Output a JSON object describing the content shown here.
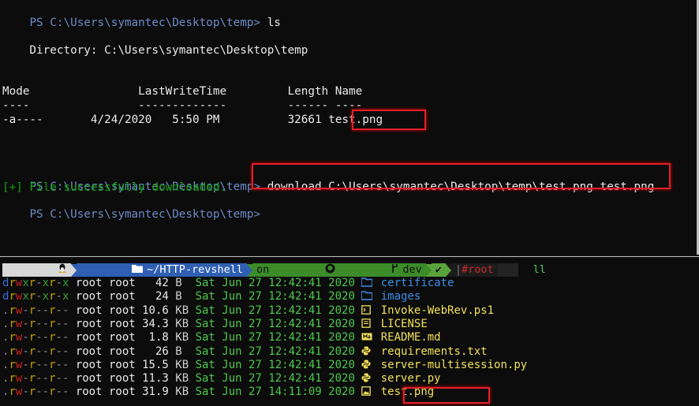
{
  "top_terminal": {
    "cmd1_prompt": "PS C:\\Users\\symantec\\Desktop\\temp>",
    "cmd1": "ls",
    "directory_label": "    Directory: C:\\Users\\symantec\\Desktop\\temp",
    "table_header": "Mode                LastWriteTime         Length Name",
    "table_rule": "----                -------------         ------ ----",
    "row_mode": "-a----",
    "row_date": "4/24/2020",
    "row_time": "5:50 PM",
    "row_length": "32661",
    "row_name": "test.png",
    "cmd2_prompt": "PS C:\\Users\\symantec\\Desktop\\temp>",
    "cmd2": "download C:\\Users\\symantec\\Desktop\\temp\\test.png test.png",
    "success_msg": "[+] File successfully downloaded.",
    "cmd3_prompt": "PS C:\\Users\\symantec\\Desktop\\temp>"
  },
  "bottom_terminal": {
    "prompt": {
      "os_icon": "linux-icon",
      "path_icon": "folder-icon",
      "path": "~/HTTP-revshell",
      "git_on": "on",
      "git_icon": "github-icon",
      "branch_icon": "branch-icon",
      "branch": "dev",
      "status_check": "✔",
      "root_label": "#root",
      "command": "ll"
    },
    "listing": [
      {
        "perm": "drwxr-xr-x",
        "owner": "root",
        "group": "root",
        "size": "42",
        "unit": "B",
        "date": "Sat Jun 27 12:42:41 2020",
        "icon": "folder-icon",
        "name": "certificate",
        "is_dir": true
      },
      {
        "perm": "drwxr-xr-x",
        "owner": "root",
        "group": "root",
        "size": "24",
        "unit": "B",
        "date": "Sat Jun 27 12:42:41 2020",
        "icon": "folder-icon",
        "name": "images",
        "is_dir": true
      },
      {
        "perm": ".rw-r--r--",
        "owner": "root",
        "group": "root",
        "size": "10.6",
        "unit": "KB",
        "date": "Sat Jun 27 12:42:41 2020",
        "icon": "terminal-icon",
        "name": "Invoke-WebRev.ps1",
        "is_dir": false
      },
      {
        "perm": ".rw-r--r--",
        "owner": "root",
        "group": "root",
        "size": "34.3",
        "unit": "KB",
        "date": "Sat Jun 27 12:42:41 2020",
        "icon": "license-icon",
        "name": "LICENSE",
        "is_dir": false
      },
      {
        "perm": ".rw-r--r--",
        "owner": "root",
        "group": "root",
        "size": "1.8",
        "unit": "KB",
        "date": "Sat Jun 27 12:42:41 2020",
        "icon": "markdown-icon",
        "name": "README.md",
        "is_dir": false
      },
      {
        "perm": ".rw-r--r--",
        "owner": "root",
        "group": "root",
        "size": "26",
        "unit": "B",
        "date": "Sat Jun 27 12:42:41 2020",
        "icon": "python-icon",
        "name": "requirements.txt",
        "is_dir": false
      },
      {
        "perm": ".rw-r--r--",
        "owner": "root",
        "group": "root",
        "size": "15.5",
        "unit": "KB",
        "date": "Sat Jun 27 12:42:41 2020",
        "icon": "python-icon",
        "name": "server-multisession.py",
        "is_dir": false
      },
      {
        "perm": ".rw-r--r--",
        "owner": "root",
        "group": "root",
        "size": "11.3",
        "unit": "KB",
        "date": "Sat Jun 27 12:42:41 2020",
        "icon": "python-icon",
        "name": "server.py",
        "is_dir": false
      },
      {
        "perm": ".rw-r--r--",
        "owner": "root",
        "group": "root",
        "size": "31.9",
        "unit": "KB",
        "date": "Sat Jun 27 14:11:09 2020",
        "icon": "image-icon",
        "name": "test.png",
        "is_dir": false
      }
    ]
  },
  "colors": {
    "highlight_box": "#e0212b",
    "ps_prompt": "#6d8bc7",
    "success_green": "#13a10e",
    "powerline_path_bg": "#2f5fb3",
    "powerline_git_bg": "#3c8c2a",
    "powerline_root_bg": "#1c1c1c"
  }
}
